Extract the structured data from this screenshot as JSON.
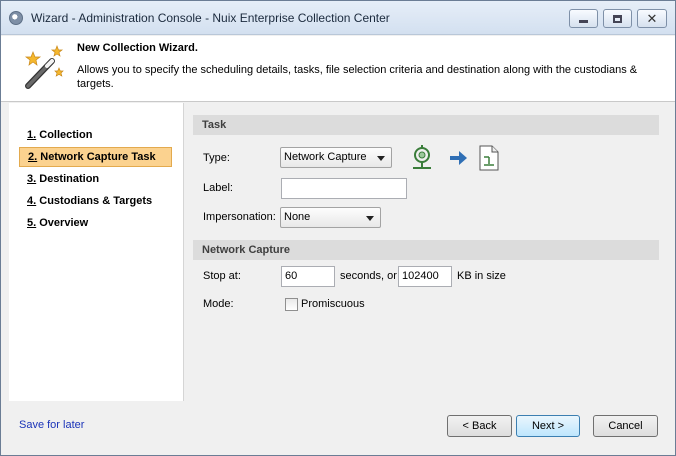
{
  "window": {
    "title": "Wizard - Administration Console - Nuix Enterprise Collection Center"
  },
  "header": {
    "title": "New Collection Wizard.",
    "description": "Allows you to specify the scheduling details, tasks, file selection criteria and destination along with the custodians & targets."
  },
  "nav": {
    "items": [
      {
        "num": "1.",
        "label": "Collection",
        "active": false
      },
      {
        "num": "2.",
        "label": "Network Capture Task",
        "active": true
      },
      {
        "num": "3.",
        "label": "Destination",
        "active": false
      },
      {
        "num": "4.",
        "label": "Custodians & Targets",
        "active": false
      },
      {
        "num": "5.",
        "label": "Overview",
        "active": false
      }
    ]
  },
  "task": {
    "section_title": "Task",
    "type_label": "Type:",
    "type_value": "Network Capture",
    "label_label": "Label:",
    "label_value": "",
    "impersonation_label": "Impersonation:",
    "impersonation_value": "None"
  },
  "network_capture": {
    "section_title": "Network Capture",
    "stop_at_label": "Stop at:",
    "seconds_value": "60",
    "seconds_suffix": "seconds, or",
    "size_value": "102400",
    "size_suffix": "KB in size",
    "mode_label": "Mode:",
    "promiscuous_label": "Promiscuous",
    "promiscuous_checked": false
  },
  "footer": {
    "save_for_later": "Save for later",
    "back": "< Back",
    "next": "Next >",
    "cancel": "Cancel"
  },
  "colors": {
    "active_nav_bg": "#fbd28f",
    "link": "#1a33b8",
    "section_header_bg": "#dcdcdc",
    "flow_arrow": "#2f6fb5"
  },
  "icons": {
    "task_flow": [
      "network-capture-icon",
      "arrow-right-icon",
      "document-icon"
    ]
  }
}
